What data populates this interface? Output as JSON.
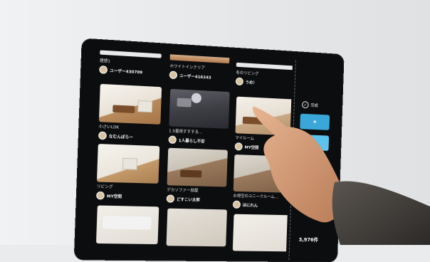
{
  "cards": [
    {
      "title": "理想1",
      "user": "ユーザー430709",
      "avatar": ""
    },
    {
      "title": "ホワイトインテリア",
      "user": "ユーザー416243",
      "avatar": ""
    },
    {
      "title": "冬のリビング",
      "user": "うめ！",
      "avatar": ""
    },
    {
      "title": "小さいLDK",
      "user": "なむんぽらー",
      "avatar": ""
    },
    {
      "title": "1.5畳用すすする…",
      "user": "1人暮らし不安",
      "avatar": ""
    },
    {
      "title": "マイルーム",
      "user": "MY空間",
      "avatar": ""
    },
    {
      "title": "リビング",
      "user": "MY空間",
      "avatar": ""
    },
    {
      "title": "デカソファー部屋",
      "user": "どすこい太郎",
      "avatar": ""
    },
    {
      "title": "お得空のユニークルーム…",
      "user": "ほにれん",
      "avatar": ""
    }
  ],
  "sidebar": {
    "completed_label": "完成",
    "count": "3,976件"
  },
  "icons": {
    "completed": "check-circle-icon"
  },
  "colors": {
    "screen": "#0c0d0f",
    "accent": "#3aa7d8"
  }
}
